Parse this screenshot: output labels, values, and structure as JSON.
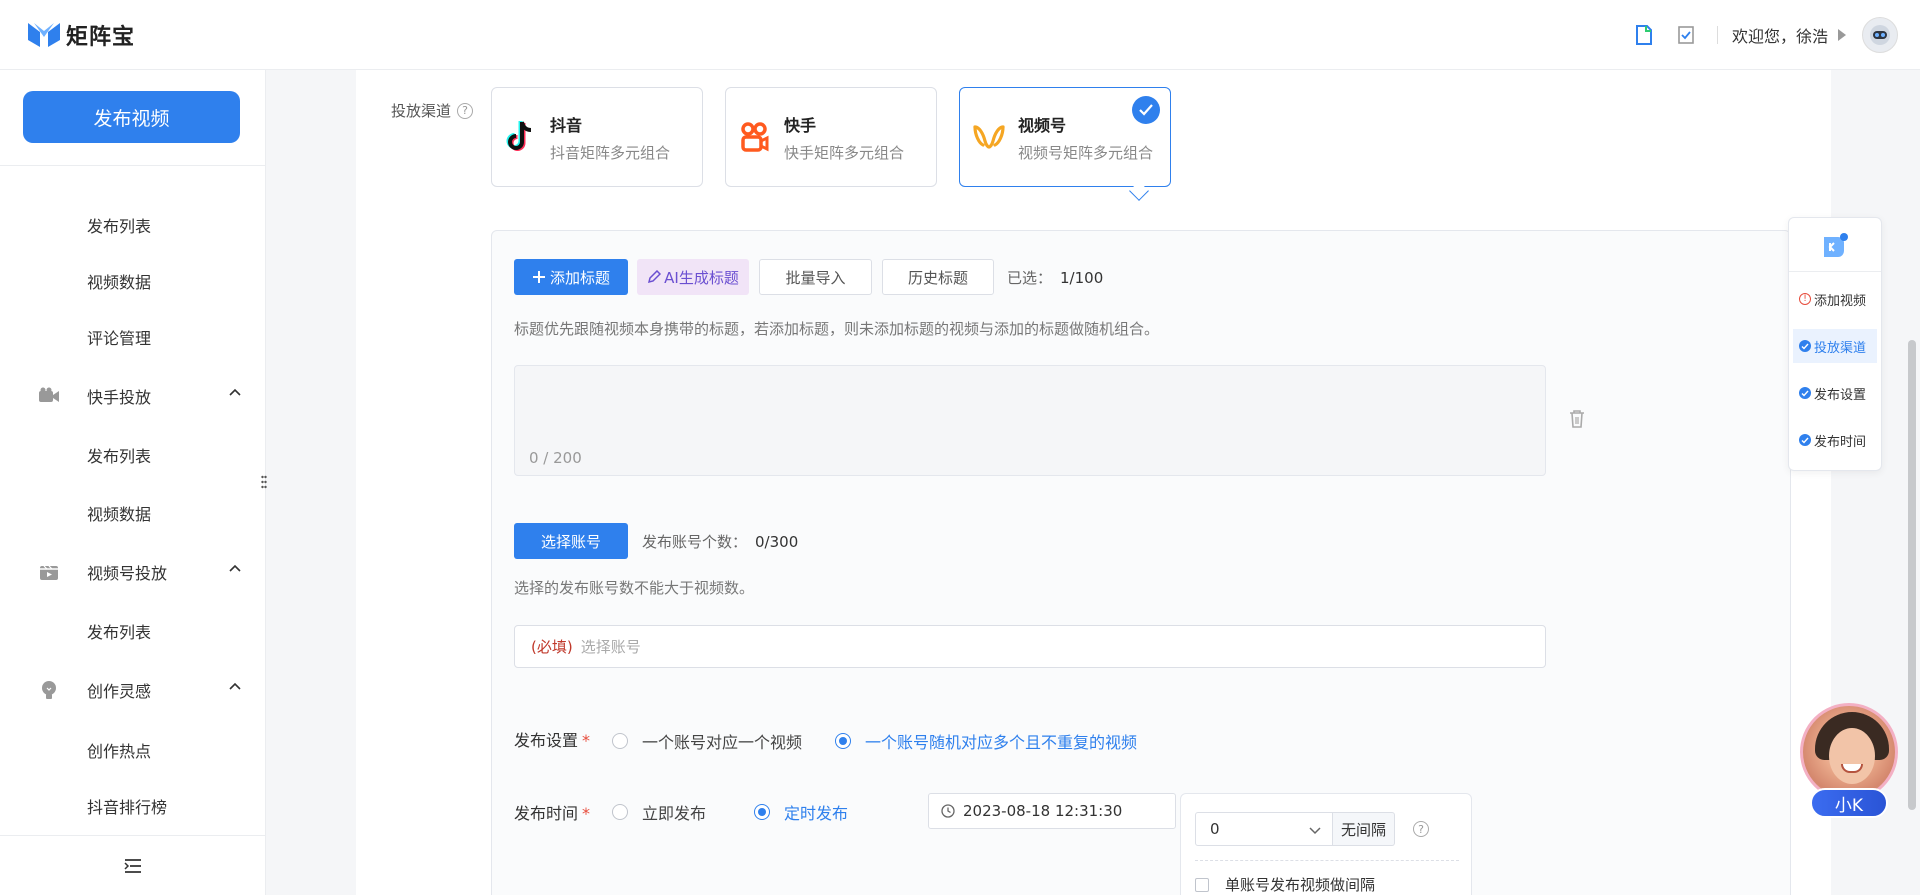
{
  "header": {
    "logo_text": "矩阵宝",
    "welcome": "欢迎您，徐浩",
    "icons": [
      "doc-icon",
      "checklist-icon"
    ]
  },
  "sidebar": {
    "publish_button": "发布视频",
    "items": [
      {
        "label": "发布列表"
      },
      {
        "label": "视频数据"
      },
      {
        "label": "评论管理"
      }
    ],
    "groups": [
      {
        "label": "快手投放",
        "children": [
          "发布列表",
          "视频数据"
        ]
      },
      {
        "label": "视频号投放",
        "children": [
          "发布列表"
        ]
      },
      {
        "label": "创作灵感",
        "children": [
          "创作热点",
          "抖音排行榜"
        ]
      }
    ]
  },
  "channels": {
    "label": "投放渠道",
    "help": "?",
    "options": [
      {
        "name": "抖音",
        "desc": "抖音矩阵多元组合",
        "selected": false
      },
      {
        "name": "快手",
        "desc": "快手矩阵多元组合",
        "selected": false
      },
      {
        "name": "视频号",
        "desc": "视频号矩阵多元组合",
        "selected": true
      }
    ]
  },
  "titles": {
    "add_button": "添加标题",
    "ai_button": "AI生成标题",
    "import_button": "批量导入",
    "history_button": "历史标题",
    "selected_label": "已选：",
    "selected_value": "1/100",
    "hint": "标题优先跟随视频本身携带的标题，若添加标题，则未添加标题的视频与添加的标题做随机组合。",
    "counter": "0 / 200"
  },
  "accounts": {
    "select_button": "选择账号",
    "count_label": "发布账号个数：",
    "count_value": "0/300",
    "hint": "选择的发布账号数不能大于视频数。",
    "required": "(必填)",
    "placeholder": "选择账号"
  },
  "publish_settings": {
    "label": "发布设置",
    "star": "*",
    "options": [
      {
        "label": "一个账号对应一个视频",
        "checked": false
      },
      {
        "label": "一个账号随机对应多个且不重复的视频",
        "checked": true
      }
    ]
  },
  "publish_time": {
    "label": "发布时间",
    "star": "*",
    "options": [
      {
        "label": "立即发布",
        "checked": false
      },
      {
        "label": "定时发布",
        "checked": true
      }
    ],
    "datetime": "2023-08-18 12:31:30",
    "interval_value": "0",
    "interval_addon": "无间隔",
    "interval_checkbox": "单账号发布视频做间隔"
  },
  "steps": {
    "items": [
      {
        "label": "添加视频",
        "status": "warn"
      },
      {
        "label": "投放渠道",
        "status": "ok",
        "active": true
      },
      {
        "label": "发布设置",
        "status": "ok"
      },
      {
        "label": "发布时间",
        "status": "ok"
      }
    ]
  },
  "assistant": {
    "badge": "小K"
  },
  "colors": {
    "primary": "#2f80ed",
    "ai": "#6b4fd1",
    "required": "#e74c3c"
  }
}
